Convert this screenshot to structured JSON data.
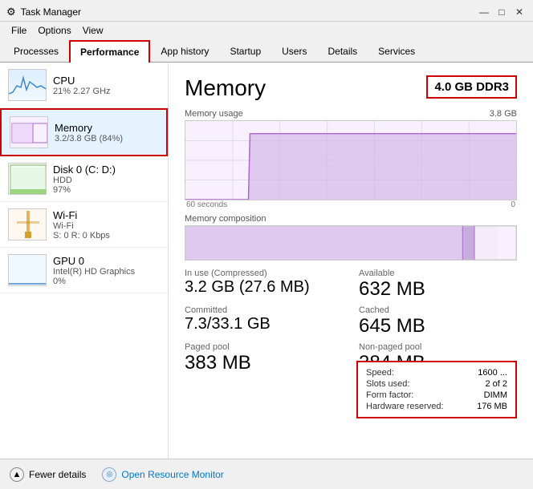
{
  "window": {
    "title": "Task Manager",
    "icon": "⚙"
  },
  "menu": {
    "items": [
      "File",
      "Options",
      "View"
    ]
  },
  "tabs": [
    {
      "id": "processes",
      "label": "Processes",
      "active": false
    },
    {
      "id": "performance",
      "label": "Performance",
      "active": true
    },
    {
      "id": "app-history",
      "label": "App history",
      "active": false
    },
    {
      "id": "startup",
      "label": "Startup",
      "active": false
    },
    {
      "id": "users",
      "label": "Users",
      "active": false
    },
    {
      "id": "details",
      "label": "Details",
      "active": false
    },
    {
      "id": "services",
      "label": "Services",
      "active": false
    }
  ],
  "sidebar": {
    "items": [
      {
        "id": "cpu",
        "name": "CPU",
        "detail1": "21% 2.27 GHz",
        "detail2": "",
        "active": false
      },
      {
        "id": "memory",
        "name": "Memory",
        "detail1": "3.2/3.8 GB (84%)",
        "detail2": "",
        "active": true
      },
      {
        "id": "disk",
        "name": "Disk 0 (C: D:)",
        "detail1": "HDD",
        "detail2": "97%",
        "active": false
      },
      {
        "id": "wifi",
        "name": "Wi-Fi",
        "detail1": "Wi-Fi",
        "detail2": "S: 0 R: 0 Kbps",
        "active": false
      },
      {
        "id": "gpu",
        "name": "GPU 0",
        "detail1": "Intel(R) HD Graphics",
        "detail2": "0%",
        "active": false
      }
    ]
  },
  "detail": {
    "title": "Memory",
    "badge": "4.0 GB DDR3",
    "chart_label_left": "Memory usage",
    "chart_label_right": "3.8 GB",
    "time_label_left": "60 seconds",
    "time_label_right": "0",
    "composition_label": "Memory composition",
    "stats": [
      {
        "label": "In use (Compressed)",
        "value": "3.2 GB (27.6 MB)"
      },
      {
        "label": "Available",
        "value": "632 MB"
      },
      {
        "label": "Committed",
        "value": "7.3/33.1 GB"
      },
      {
        "label": "Cached",
        "value": "645 MB"
      },
      {
        "label": "Paged pool",
        "value": "383 MB"
      },
      {
        "label": "Non-paged pool",
        "value": "384 MB"
      }
    ],
    "info": {
      "speed_label": "Speed:",
      "speed_value": "1600 ...",
      "slots_label": "Slots used:",
      "slots_value": "2 of 2",
      "form_label": "Form factor:",
      "form_value": "DIMM",
      "reserved_label": "Hardware reserved:",
      "reserved_value": "176 MB"
    }
  },
  "bottom": {
    "fewer_details": "Fewer details",
    "open_resource_monitor": "Open Resource Monitor"
  },
  "titlebar_controls": {
    "minimize": "—",
    "maximize": "□",
    "close": "✕"
  }
}
